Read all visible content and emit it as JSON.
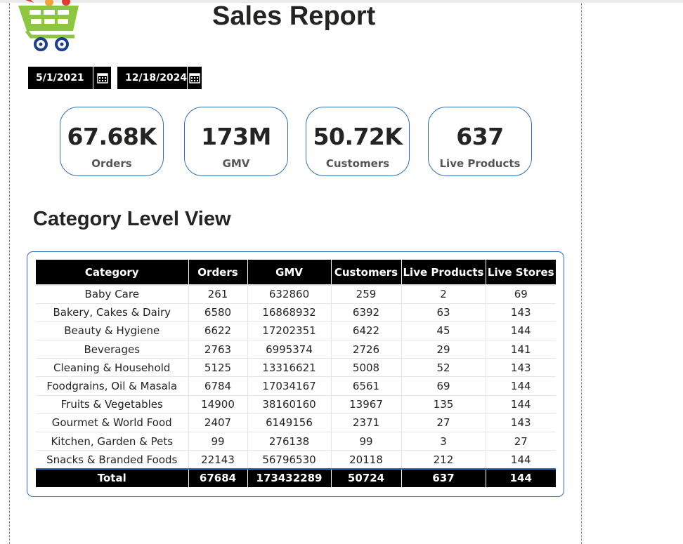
{
  "report": {
    "title": "Sales Report",
    "logo_icon": "shopping-cart-icon"
  },
  "filters": {
    "start_date": "5/1/2021",
    "end_date": "12/18/2024",
    "calendar_icon": "calendar-icon"
  },
  "kpis": [
    {
      "value": "67.68K",
      "label": "Orders"
    },
    {
      "value": "173M",
      "label": "GMV"
    },
    {
      "value": "50.72K",
      "label": "Customers"
    },
    {
      "value": "637",
      "label": "Live Products"
    }
  ],
  "section_title": "Category Level View",
  "table": {
    "headers": [
      "Category",
      "Orders",
      "GMV",
      "Customers",
      "Live Products",
      "Live Stores"
    ],
    "rows": [
      [
        "Baby Care",
        "261",
        "632860",
        "259",
        "2",
        "69"
      ],
      [
        "Bakery, Cakes & Dairy",
        "6580",
        "16868932",
        "6392",
        "63",
        "143"
      ],
      [
        "Beauty & Hygiene",
        "6622",
        "17202351",
        "6422",
        "45",
        "144"
      ],
      [
        "Beverages",
        "2763",
        "6995374",
        "2726",
        "29",
        "141"
      ],
      [
        "Cleaning & Household",
        "5125",
        "13316621",
        "5008",
        "52",
        "143"
      ],
      [
        "Foodgrains, Oil & Masala",
        "6784",
        "17034167",
        "6561",
        "69",
        "144"
      ],
      [
        "Fruits & Vegetables",
        "14900",
        "38160160",
        "13967",
        "135",
        "144"
      ],
      [
        "Gourmet & World Food",
        "2407",
        "6149156",
        "2371",
        "27",
        "143"
      ],
      [
        "Kitchen, Garden & Pets",
        "99",
        "276138",
        "99",
        "3",
        "27"
      ],
      [
        "Snacks & Branded Foods",
        "22143",
        "56796530",
        "20118",
        "212",
        "144"
      ]
    ],
    "total": [
      "Total",
      "67684",
      "173432289",
      "50724",
      "637",
      "144"
    ]
  },
  "colors": {
    "accent_border": "#2f6fb8",
    "header_bg": "#000000",
    "logo_green": "#8dc63f",
    "logo_navy": "#1b3f8b"
  }
}
